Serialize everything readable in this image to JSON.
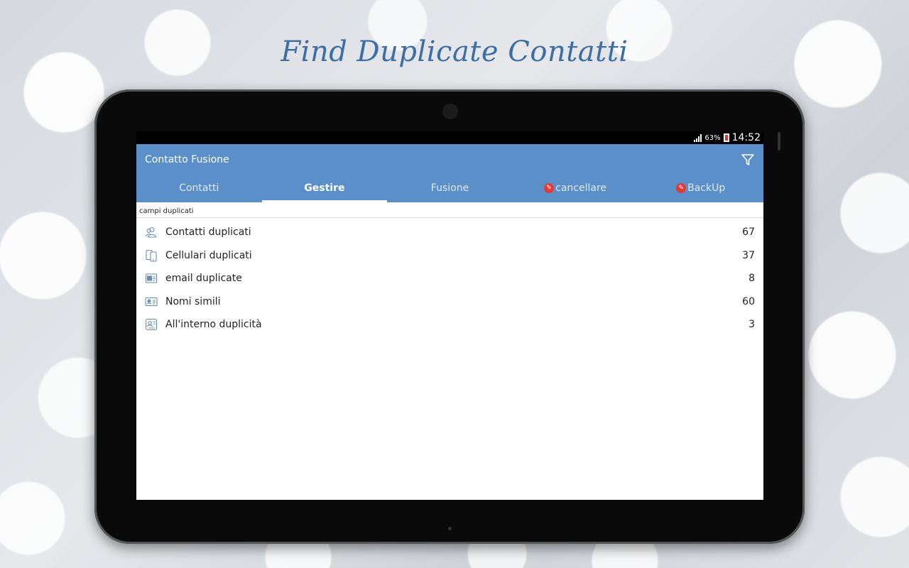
{
  "headline": "Find Duplicate Contatti",
  "status_bar": {
    "battery_percent": "63%",
    "time": "14:52"
  },
  "app_bar": {
    "title": "Contatto Fusione",
    "filter_icon": "filter-icon"
  },
  "tabs": [
    {
      "label": "Contatti",
      "active": false
    },
    {
      "label": "Gestire",
      "active": true
    },
    {
      "label": "Fusione",
      "active": false
    },
    {
      "label": "cancellare",
      "active": false,
      "badge_icon": "pro-badge-icon"
    },
    {
      "label": "BackUp",
      "active": false,
      "badge_icon": "pro-badge-icon"
    }
  ],
  "section": {
    "header": "campi duplicati",
    "items": [
      {
        "label": "Contatti duplicati",
        "count": "67",
        "icon": "contacts-icon"
      },
      {
        "label": "Cellulari duplicati",
        "count": "37",
        "icon": "phones-icon"
      },
      {
        "label": "email duplicate",
        "count": "8",
        "icon": "email-icon"
      },
      {
        "label": "Nomi simili",
        "count": "60",
        "icon": "id-card-icon"
      },
      {
        "label": "All'interno duplicità",
        "count": "3",
        "icon": "internal-duplicate-icon"
      }
    ]
  },
  "colors": {
    "headline": "#3d6ea3",
    "app_bar": "#5b8fc9",
    "badge": "#e53935"
  }
}
